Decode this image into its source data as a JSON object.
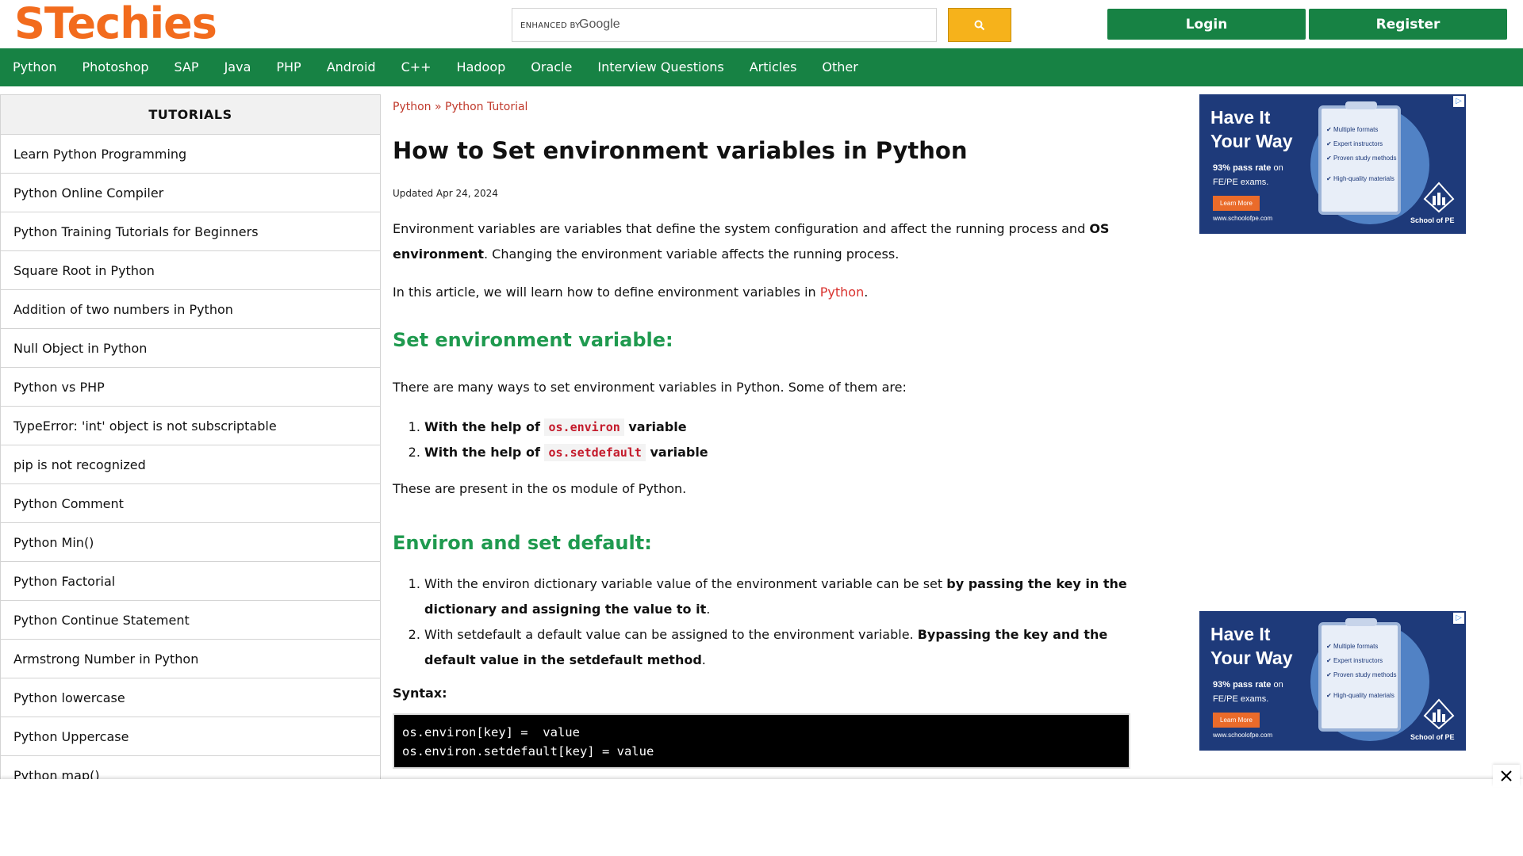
{
  "header": {
    "logo": "STechies",
    "search_enhanced": "ENHANCED BY",
    "search_google": "Google",
    "search_placeholder": "",
    "login_label": "Login",
    "register_label": "Register"
  },
  "nav": {
    "items": [
      "Python",
      "Photoshop",
      "SAP",
      "Java",
      "PHP",
      "Android",
      "C++",
      "Hadoop",
      "Oracle",
      "Interview Questions",
      "Articles",
      "Other"
    ]
  },
  "sidebar": {
    "title": "TUTORIALS",
    "items": [
      "Learn Python Programming",
      "Python Online Compiler",
      "Python Training Tutorials for Beginners",
      "Square Root in Python",
      "Addition of two numbers in Python",
      "Null Object in Python",
      "Python vs PHP",
      "TypeError: 'int' object is not subscriptable",
      "pip is not recognized",
      "Python Comment",
      "Python Min()",
      "Python Factorial",
      "Python Continue Statement",
      "Armstrong Number in Python",
      "Python lowercase",
      "Python Uppercase",
      "Python map()"
    ]
  },
  "main": {
    "breadcrumb": {
      "first": "Python",
      "sep": " » ",
      "second": "Python Tutorial"
    },
    "title": "How to Set environment variables in Python",
    "updated": "Updated Apr 24, 2024",
    "p1_a": "Environment variables are variables that define the system configuration and affect the running process and ",
    "p1_bold": "OS environment",
    "p1_b": ". Changing the environment variable affects the running process.",
    "p2_a": "In this article, we will learn how to define environment variables in ",
    "p2_link": "Python",
    "p2_b": ".",
    "h2_1": "Set environment variable:",
    "p3": "There are many ways to set environment variables in Python.  Some of them are:",
    "list1": [
      {
        "pre": "With the help of ",
        "code": "os.environ",
        "post": " variable"
      },
      {
        "pre": "With the help of ",
        "code": "os.setdefault",
        "post": " variable"
      }
    ],
    "p4": "These are present in the os module of Python.",
    "h2_2": "Environ and set default:",
    "list2": [
      {
        "text": "With the environ dictionary variable value of the environment variable can be set ",
        "bold": "by passing the key in the dictionary and assigning the value to it",
        "tail": "."
      },
      {
        "text": "With setdefault a default value can be assigned to the environment variable. ",
        "bold": "Bypassing the key and the default value in the setdefault method",
        "tail": "."
      }
    ],
    "syntax_label": "Syntax:",
    "code_lines": [
      "os.environ[key] =  value",
      "os.environ.setdefault[key] = value"
    ]
  },
  "ads": {
    "title_line1": "Have It",
    "title_line2": "Your Way",
    "sub_bold": "93% pass rate",
    "sub_rest": " on",
    "sub_line2": "FE/PE exams.",
    "cta": "Learn More",
    "url": "www.schoolofpe.com",
    "checks": [
      "Multiple formats",
      "Expert instructors",
      "Proven study methods",
      "High-quality materials"
    ],
    "brand": "School of PE"
  },
  "colors": {
    "brand_orange": "#f26b1d",
    "nav_green": "#178244",
    "heading_green": "#1f9a4f",
    "link_red": "#d9332f",
    "search_yellow": "#f6b21b"
  }
}
